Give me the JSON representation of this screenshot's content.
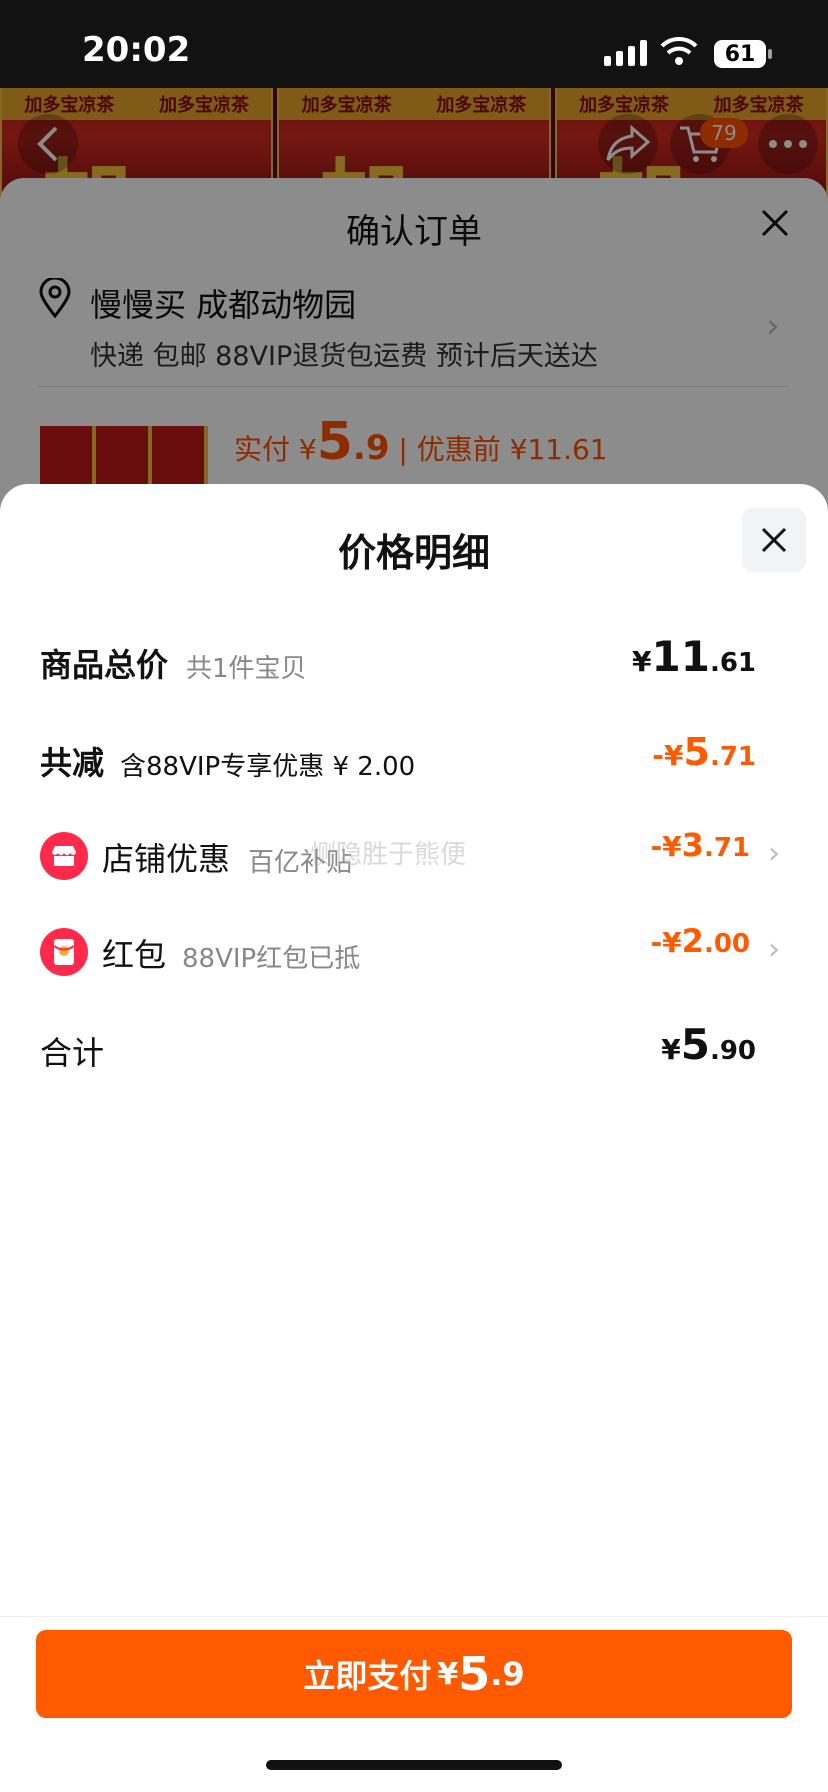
{
  "status_bar": {
    "time": "20:02",
    "battery": "61"
  },
  "background": {
    "product_can_text": "加多宝凉茶",
    "product_big_char": "加",
    "cart_count": "79"
  },
  "order": {
    "title": "确认订单",
    "address_name": "慢慢买 成都动物园",
    "address_detail": "快递 包邮 88VIP退货包运费 预计后天送达",
    "pay_prefix": "实付 ¥",
    "pay_int": "5",
    "pay_dec": ".9",
    "before_discount": "| 优惠前 ¥11.61"
  },
  "price_detail": {
    "title": "价格明细",
    "rows": [
      {
        "label": "商品总价",
        "sub": "共1件宝贝",
        "yen": "¥",
        "int": "11",
        "dec": ".61"
      },
      {
        "label": "共减",
        "sub": "含88VIP专享优惠 ¥ 2.00",
        "yen": "-¥",
        "int": "5",
        "dec": ".71"
      },
      {
        "label": "店铺优惠",
        "sub": "百亿补贴",
        "yen": "-¥",
        "int": "3",
        "dec": ".71"
      },
      {
        "label": "红包",
        "sub": "88VIP红包已抵",
        "yen": "-¥",
        "int": "2",
        "dec": ".00"
      },
      {
        "label": "合计",
        "sub": "",
        "yen": "¥",
        "int": "5",
        "dec": ".90"
      }
    ],
    "watermark": "恻隐胜于熊便"
  },
  "pay_button": {
    "label": "立即支付",
    "yen": "¥",
    "int": "5",
    "dec": ".9"
  },
  "colors": {
    "accent": "#ff5a00",
    "shop_icon": "#ff2a4b"
  },
  "icons": [
    "back-icon",
    "share-icon",
    "cart-icon",
    "more-icon",
    "location-pin-icon",
    "close-icon",
    "shop-icon",
    "red-packet-icon",
    "chevron-right-icon"
  ]
}
